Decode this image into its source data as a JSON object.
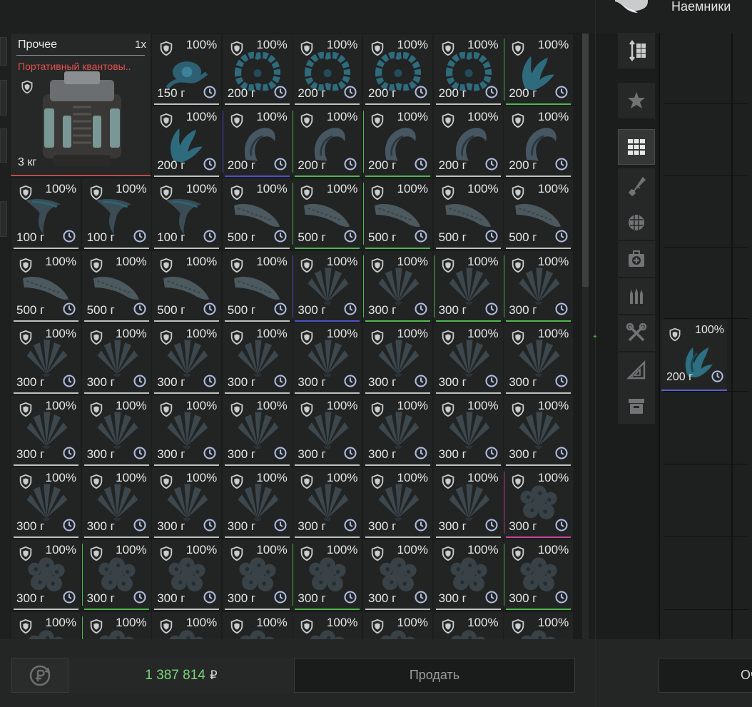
{
  "inventory": {
    "featured_item": {
      "category": "Прочее",
      "quantity": "1x",
      "name": "Портативный квантовы..",
      "weight": "3 кг",
      "rarity_color": "#c24a4a"
    },
    "columns": 8,
    "durability_label": "100%",
    "items": [
      {
        "weight": "150 г",
        "art": "orb"
      },
      {
        "weight": "200 г",
        "art": "wreath"
      },
      {
        "weight": "200 г",
        "art": "wreath"
      },
      {
        "weight": "200 г",
        "art": "wreath"
      },
      {
        "weight": "200 г",
        "art": "wreath"
      },
      {
        "weight": "200 г",
        "art": "claw",
        "accent": "#4fb84f"
      },
      {
        "weight": "200 г",
        "art": "claw"
      },
      {
        "weight": "200 г",
        "art": "hook",
        "accent": "#4e52c8"
      },
      {
        "weight": "200 г",
        "art": "hook",
        "accent": "#4fb84f"
      },
      {
        "weight": "200 г",
        "art": "hook",
        "accent": "#4fb84f"
      },
      {
        "weight": "200 г",
        "art": "hook"
      },
      {
        "weight": "200 г",
        "art": "hook"
      },
      {
        "weight": "100 г",
        "art": "scythe"
      },
      {
        "weight": "100 г",
        "art": "scythe"
      },
      {
        "weight": "100 г",
        "art": "scythe"
      },
      {
        "weight": "500 г",
        "art": "log"
      },
      {
        "weight": "500 г",
        "art": "log",
        "accent": "#4fb84f"
      },
      {
        "weight": "500 г",
        "art": "log",
        "accent": "#4fb84f"
      },
      {
        "weight": "500 г",
        "art": "log"
      },
      {
        "weight": "500 г",
        "art": "log"
      },
      {
        "weight": "500 г",
        "art": "log"
      },
      {
        "weight": "500 г",
        "art": "log"
      },
      {
        "weight": "500 г",
        "art": "log"
      },
      {
        "weight": "500 г",
        "art": "log"
      },
      {
        "weight": "300 г",
        "art": "fan",
        "accent": "#4e52c8"
      },
      {
        "weight": "300 г",
        "art": "fan",
        "accent": "#4fb84f"
      },
      {
        "weight": "300 г",
        "art": "fan",
        "accent": "#4fb84f"
      },
      {
        "weight": "300 г",
        "art": "fan",
        "accent": "#4fb84f"
      },
      {
        "weight": "300 г",
        "art": "fan"
      },
      {
        "weight": "300 г",
        "art": "fan"
      },
      {
        "weight": "300 г",
        "art": "fan"
      },
      {
        "weight": "300 г",
        "art": "fan"
      },
      {
        "weight": "300 г",
        "art": "fan"
      },
      {
        "weight": "300 г",
        "art": "fan"
      },
      {
        "weight": "300 г",
        "art": "fan"
      },
      {
        "weight": "300 г",
        "art": "fan"
      },
      {
        "weight": "300 г",
        "art": "fan"
      },
      {
        "weight": "300 г",
        "art": "fan"
      },
      {
        "weight": "300 г",
        "art": "fan"
      },
      {
        "weight": "300 г",
        "art": "fan"
      },
      {
        "weight": "300 г",
        "art": "fan"
      },
      {
        "weight": "300 г",
        "art": "fan"
      },
      {
        "weight": "300 г",
        "art": "fan"
      },
      {
        "weight": "300 г",
        "art": "fan"
      },
      {
        "weight": "300 г",
        "art": "fan"
      },
      {
        "weight": "300 г",
        "art": "fan"
      },
      {
        "weight": "300 г",
        "art": "fan"
      },
      {
        "weight": "300 г",
        "art": "fan"
      },
      {
        "weight": "300 г",
        "art": "fan"
      },
      {
        "weight": "300 г",
        "art": "fan"
      },
      {
        "weight": "300 г",
        "art": "fan"
      },
      {
        "weight": "300 г",
        "art": "coral",
        "accent": "#c8449a"
      },
      {
        "weight": "300 г",
        "art": "coral"
      },
      {
        "weight": "300 г",
        "art": "coral",
        "accent": "#4fb84f"
      },
      {
        "weight": "300 г",
        "art": "coral"
      },
      {
        "weight": "300 г",
        "art": "coral"
      },
      {
        "weight": "300 г",
        "art": "coral",
        "accent": "#4fb84f"
      },
      {
        "weight": "300 г",
        "art": "coral"
      },
      {
        "weight": "300 г",
        "art": "coral"
      },
      {
        "weight": "300 г",
        "art": "coral",
        "accent": "#4fb84f"
      },
      {
        "weight": "",
        "art": "coral"
      },
      {
        "weight": "",
        "art": "coral",
        "accent": "#4fb84f"
      },
      {
        "weight": "",
        "art": "coral"
      },
      {
        "weight": "",
        "art": "coral"
      },
      {
        "weight": "",
        "art": "coral"
      },
      {
        "weight": "",
        "art": "coral"
      },
      {
        "weight": "",
        "art": "coral"
      },
      {
        "weight": "",
        "art": "coral"
      }
    ]
  },
  "footer": {
    "balance": "1 387 814",
    "currency": "₽",
    "sell_label": "Продать",
    "right_button_label": "Оч"
  },
  "right_panel": {
    "title": "Наемники",
    "filters": [
      "sort-icon",
      "star-icon",
      "grid-icon",
      "rifle-icon",
      "grenade-icon",
      "medkit-icon",
      "ammo-icon",
      "tools-icon",
      "ruler-icon",
      "box-icon"
    ],
    "active_filter": "grid-icon",
    "item": {
      "durability": "100%",
      "weight": "200 г",
      "accent": "#5b5fd0"
    }
  },
  "colors": {
    "balance": "#7cd47c",
    "warning": "#e2514b",
    "art_teal": "#2f6f82",
    "art_gray": "#4a5a62"
  }
}
